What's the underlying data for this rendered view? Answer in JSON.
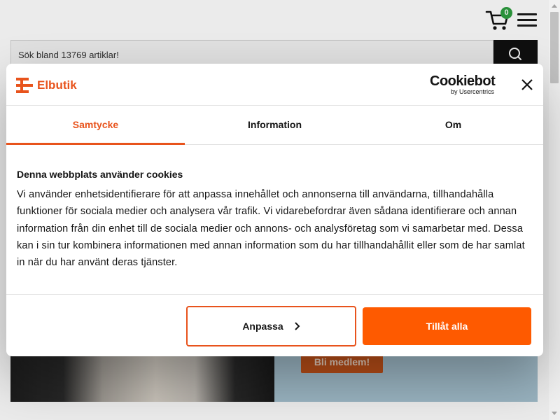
{
  "header": {
    "cart_count": "0",
    "search_placeholder": "Sök bland 13769 artiklar!"
  },
  "background": {
    "member_button": "Bli medlem!"
  },
  "dialog": {
    "logo_text": "Elbutik",
    "cookiebot_title": "Cookiebot",
    "cookiebot_subtitle": "by Usercentrics",
    "tabs": [
      {
        "label": "Samtycke",
        "active": true
      },
      {
        "label": "Information",
        "active": false
      },
      {
        "label": "Om",
        "active": false
      }
    ],
    "content_title": "Denna webbplats använder cookies",
    "content_body": "Vi använder enhetsidentifierare för att anpassa innehållet och annonserna till användarna, tillhandahålla funktioner för sociala medier och analysera vår trafik. Vi vidarebefordrar även sådana identifierare och annan information från din enhet till de sociala medier och annons- och analysföretag som vi samarbetar med. Dessa kan i sin tur kombinera informationen med annan information som du har tillhandahållit eller som de har samlat in när du har använt deras tjänster.",
    "customize_button": "Anpassa",
    "allow_all_button": "Tillåt alla"
  },
  "colors": {
    "accent": "#fe5a00",
    "brand": "#e8531c",
    "badge": "#2e9e3f"
  }
}
